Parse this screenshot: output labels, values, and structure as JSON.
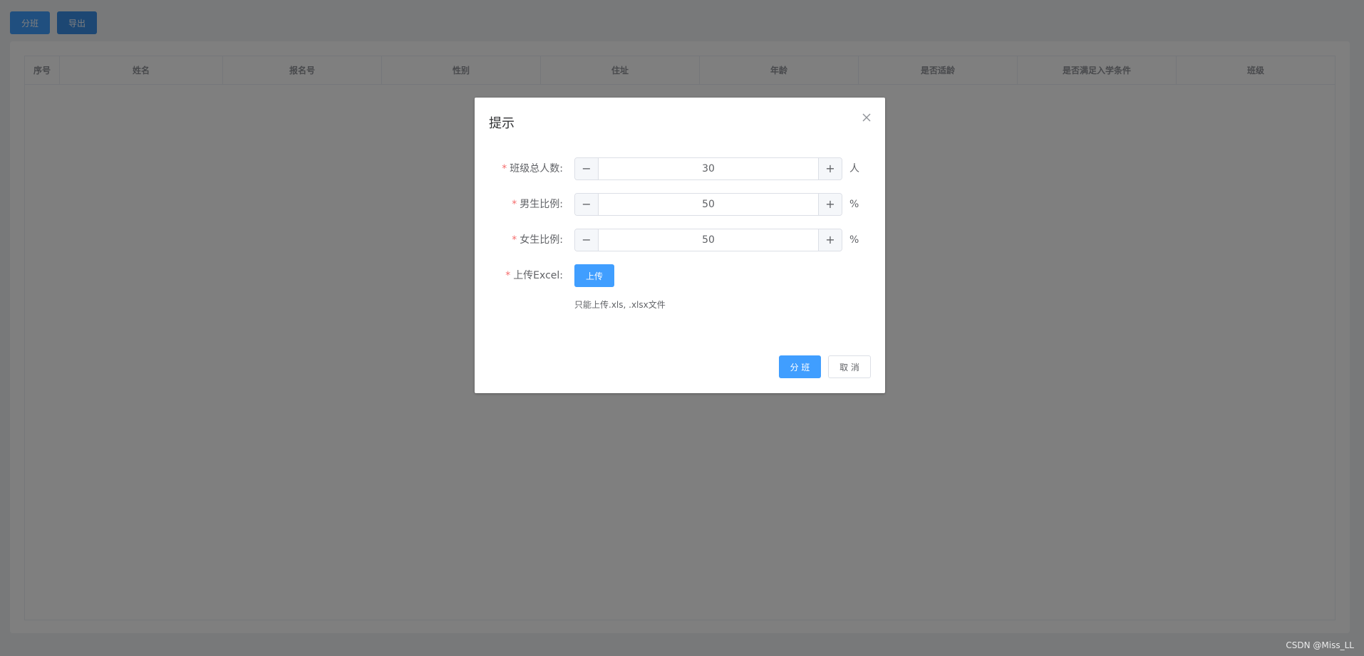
{
  "toolbar": {
    "divide_label": "分班",
    "export_label": "导出"
  },
  "table": {
    "columns": [
      "序号",
      "姓名",
      "报名号",
      "性别",
      "住址",
      "年龄",
      "是否适龄",
      "是否满足入学条件",
      "班级"
    ]
  },
  "dialog": {
    "title": "提示",
    "fields": {
      "total": {
        "label": "班级总人数:",
        "value": "30",
        "unit": "人",
        "minus": "−",
        "plus": "+"
      },
      "male": {
        "label": "男生比例:",
        "value": "50",
        "unit": "%",
        "minus": "−",
        "plus": "+"
      },
      "female": {
        "label": "女生比例:",
        "value": "50",
        "unit": "%",
        "minus": "−",
        "plus": "+"
      },
      "upload": {
        "label": "上传Excel:",
        "button": "上传",
        "tip": "只能上传.xls, .xlsx文件"
      }
    },
    "required_mark": "*",
    "confirm_label": "分 班",
    "cancel_label": "取 消"
  },
  "watermark": "CSDN @Miss_LL",
  "colors": {
    "primary": "#409eff",
    "required": "#f56c6c",
    "overlay": "rgba(0,0,0,0.5)"
  }
}
